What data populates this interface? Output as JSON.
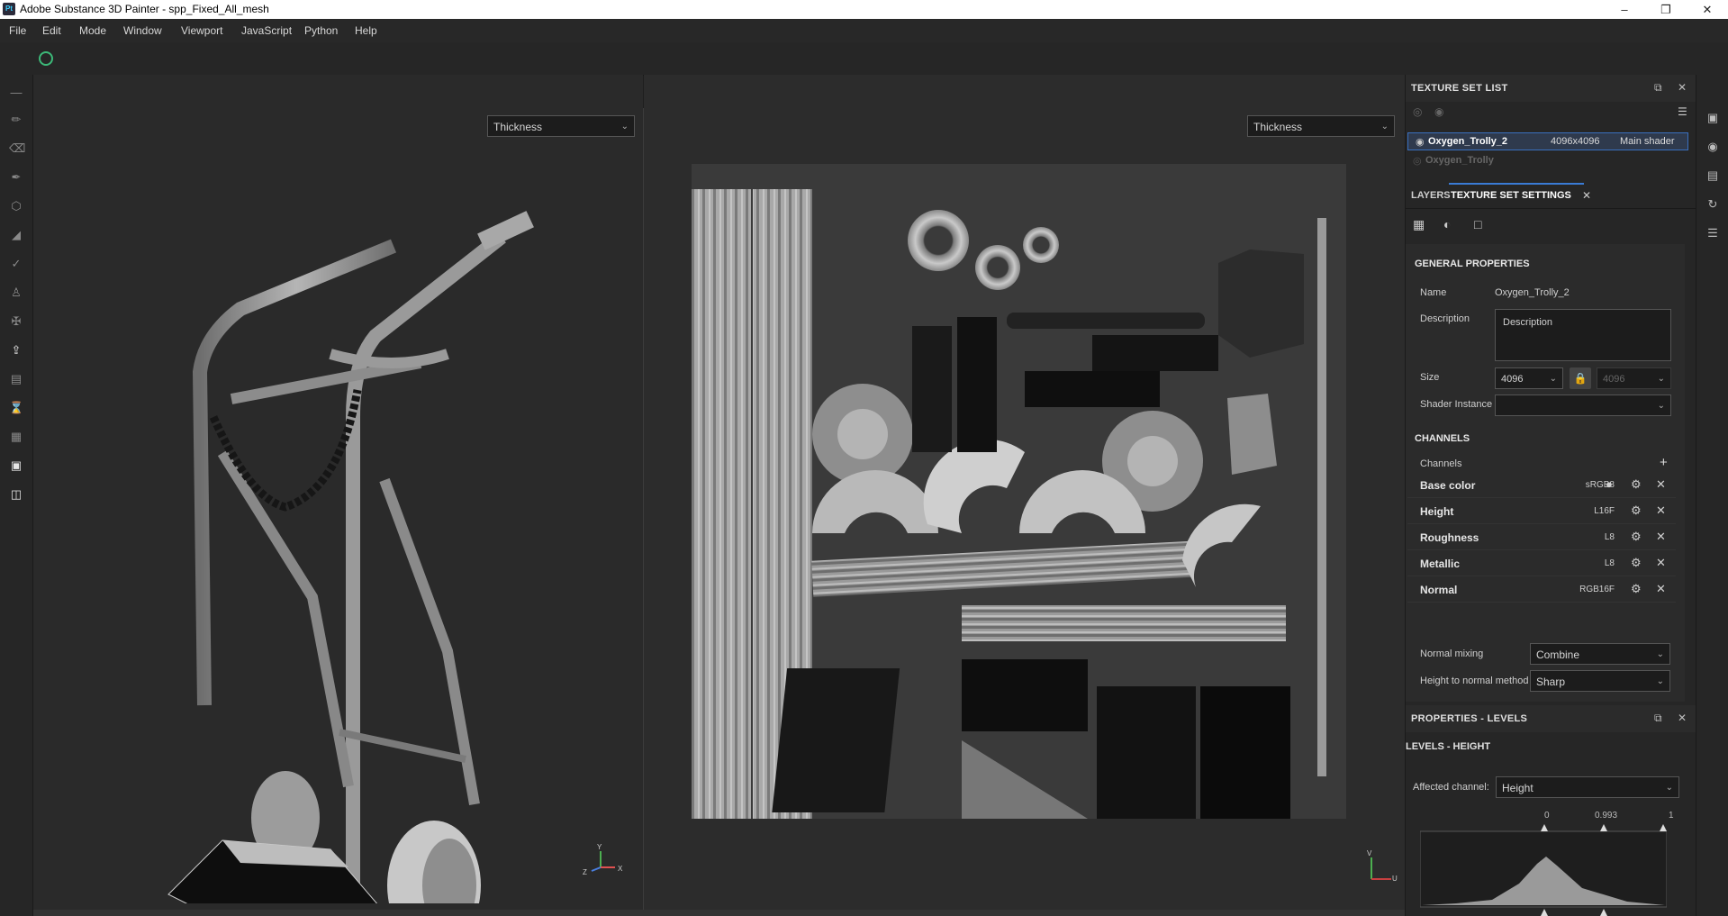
{
  "window": {
    "title": "Adobe Substance 3D Painter - spp_Fixed_All_mesh",
    "app_icon": "Pt"
  },
  "menu": [
    "File",
    "Edit",
    "Mode",
    "Window",
    "Viewport",
    "JavaScript",
    "Python",
    "Help"
  ],
  "viewport": {
    "left_channel": "Thickness",
    "right_channel": "Thickness",
    "axis_labels_3d": {
      "y": "Y",
      "z": "Z",
      "x": "X"
    },
    "axis_labels_2d": {
      "v": "V",
      "u": "U"
    }
  },
  "texture_set_list": {
    "title": "TEXTURE SET LIST",
    "items": [
      {
        "name": "Oxygen_Trolly_2",
        "size": "4096x4096",
        "shader": "Main shader",
        "selected": true
      },
      {
        "name": "Oxygen_Trolly",
        "size": "",
        "shader": "",
        "selected": false
      }
    ]
  },
  "tabs": {
    "layers": "LAYERS",
    "tss": "TEXTURE SET SETTINGS"
  },
  "general": {
    "heading": "GENERAL PROPERTIES",
    "name_label": "Name",
    "name_value": "Oxygen_Trolly_2",
    "description_label": "Description",
    "description_value": "Description",
    "size_label": "Size",
    "size_value": "4096",
    "size_value_2": "4096",
    "shader_label": "Shader Instance",
    "shader_value": ""
  },
  "channels": {
    "heading": "CHANNELS",
    "label": "Channels",
    "rows": [
      {
        "name": "Base color",
        "format": "sRGB8"
      },
      {
        "name": "Height",
        "format": "L16F"
      },
      {
        "name": "Roughness",
        "format": "L8"
      },
      {
        "name": "Metallic",
        "format": "L8"
      },
      {
        "name": "Normal",
        "format": "RGB16F"
      }
    ]
  },
  "normals": {
    "mixing_label": "Normal mixing",
    "mixing_value": "Combine",
    "method_label": "Height to normal method",
    "method_value": "Sharp"
  },
  "properties": {
    "title": "PROPERTIES - LEVELS",
    "subtitle": "LEVELS - HEIGHT",
    "affected_label": "Affected channel:",
    "affected_value": "Height",
    "levels_low": "0",
    "levels_mid": "0.993",
    "levels_high": "1"
  },
  "colors": {
    "accent": "#3a7bd5",
    "panel": "#262626",
    "viewport": "#2a2a2a"
  }
}
